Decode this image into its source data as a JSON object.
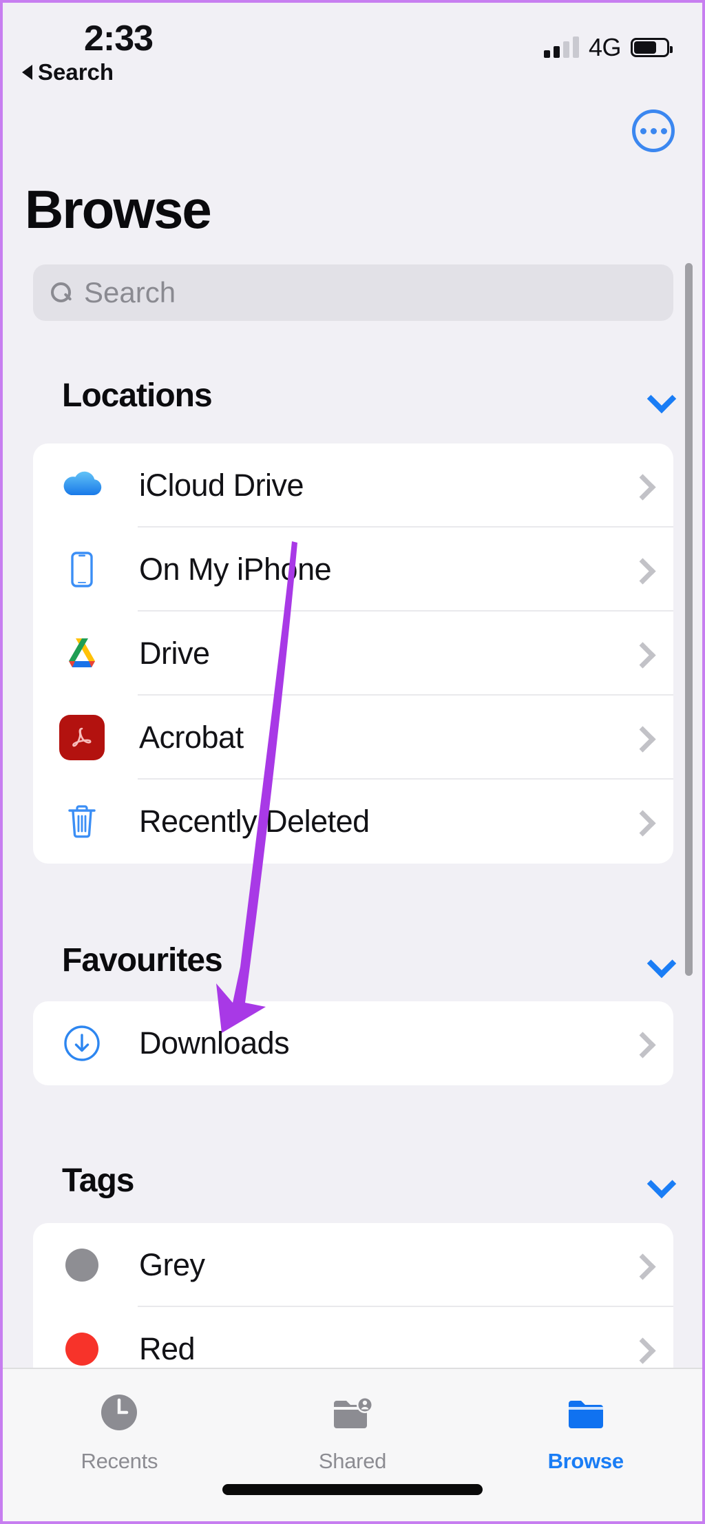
{
  "status_bar": {
    "time": "2:33",
    "network": "4G",
    "signal_bars_filled": 2,
    "signal_bars_total": 4,
    "battery_percent": 70,
    "back_label": "Search",
    "back_icon": "triangle-left-icon"
  },
  "header": {
    "title": "Browse",
    "more_button_icon": "ellipsis-circle-icon"
  },
  "search": {
    "placeholder": "Search",
    "value": "",
    "icon": "search-icon"
  },
  "sections": [
    {
      "title": "Locations",
      "collapse_icon": "chevron-down-icon",
      "items": [
        {
          "label": "iCloud Drive",
          "icon": "icloud-drive-icon",
          "accessory": "chevron-right-icon"
        },
        {
          "label": "On My iPhone",
          "icon": "iphone-icon",
          "accessory": "chevron-right-icon"
        },
        {
          "label": "Drive",
          "icon": "google-drive-icon",
          "accessory": "chevron-right-icon"
        },
        {
          "label": "Acrobat",
          "icon": "adobe-acrobat-icon",
          "accessory": "chevron-right-icon"
        },
        {
          "label": "Recently Deleted",
          "icon": "trash-icon",
          "accessory": "chevron-right-icon"
        }
      ]
    },
    {
      "title": "Favourites",
      "collapse_icon": "chevron-down-icon",
      "items": [
        {
          "label": "Downloads",
          "icon": "download-circle-icon",
          "accessory": "chevron-right-icon"
        }
      ]
    },
    {
      "title": "Tags",
      "collapse_icon": "chevron-down-icon",
      "items": [
        {
          "label": "Grey",
          "icon": "tag-dot-grey-icon",
          "color": "#8e8e93",
          "accessory": "chevron-right-icon"
        },
        {
          "label": "Red",
          "icon": "tag-dot-red-icon",
          "color": "#f7332a",
          "accessory": "chevron-right-icon"
        }
      ]
    }
  ],
  "tab_bar": {
    "tabs": [
      {
        "label": "Recents",
        "icon": "clock-icon",
        "active": false
      },
      {
        "label": "Shared",
        "icon": "shared-folder-icon",
        "active": false
      },
      {
        "label": "Browse",
        "icon": "folder-icon",
        "active": true
      }
    ]
  },
  "annotation": {
    "type": "arrow",
    "color": "#a839e6",
    "points_to": "Downloads"
  },
  "colors": {
    "accent_blue": "#1a7df5",
    "page_background": "#f1f0f5",
    "card_background": "#ffffff",
    "annotation_purple": "#a839e6",
    "tag_grey": "#8e8e93",
    "tag_red": "#f7332a",
    "frame_border": "#c77ef0"
  }
}
